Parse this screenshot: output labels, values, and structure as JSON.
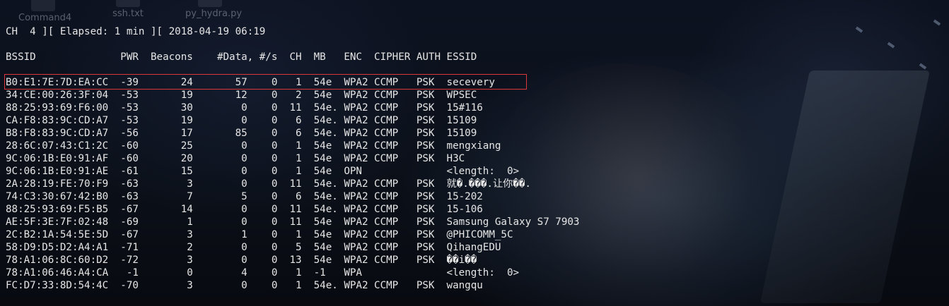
{
  "desktop_icons": [
    "Command4",
    "ssh.txt",
    "py_hydra.py"
  ],
  "status_line": "CH  4 ][ Elapsed: 1 min ][ 2018-04-19 06:19",
  "header_line": "BSSID              PWR  Beacons    #Data, #/s  CH  MB   ENC  CIPHER AUTH ESSID",
  "rows": [
    "B0:E1:7E:7D:EA:CC  -39       24       57    0   1  54e  WPA2 CCMP   PSK  secevery",
    "34:CE:00:26:3F:04  -53       19       12    0   2  54e  WPA2 CCMP   PSK  WPSEC",
    "88:25:93:69:F6:00  -53       30        0    0  11  54e. WPA2 CCMP   PSK  15#116",
    "CA:F8:83:9C:CD:A7  -53       19        0    0   6  54e. WPA2 CCMP   PSK  15109",
    "B8:F8:83:9C:CD:A7  -56       17       85    0   6  54e. WPA2 CCMP   PSK  15109",
    "28:6C:07:43:C1:2C  -60       25        0    0   1  54e  WPA2 CCMP   PSK  mengxiang",
    "9C:06:1B:E0:91:AF  -60       20        0    0   1  54e  WPA2 CCMP   PSK  H3C",
    "9C:06:1B:E0:91:AE  -61       15        0    0   1  54e  OPN              <length:  0>",
    "2A:28:19:FE:70:F9  -63        3        0    0  11  54e. WPA2 CCMP   PSK  就�.���.让你��.",
    "74:C3:30:67:42:B0  -63        7        5    0   6  54e. WPA2 CCMP   PSK  15-202",
    "88:25:93:69:F5:B5  -67       14        0    0  11  54e. WPA2 CCMP   PSK  15-106",
    "AE:5F:3E:7F:02:48  -69        1        0    0  11  54e  WPA2 CCMP   PSK  Samsung Galaxy S7 7903",
    "2C:B2:1A:54:5E:5D  -67        3        1    0   1  54e  WPA2 CCMP   PSK  @PHICOMM_5C",
    "58:D9:D5:D2:A4:A1  -71        2        0    0   5  54e  WPA2 CCMP   PSK  QihangEDU",
    "78:A1:06:8C:60:D2  -72        3        0    0  13  54e  WPA2 CCMP   PSK  ��i��",
    "78:A1:06:46:A4:CA   -1        0        4    0   1  -1   WPA              <length:  0>",
    "FC:D7:33:8D:54:4C  -70        3        0    0   1  54e. WPA2 CCMP   PSK  wangqu"
  ]
}
